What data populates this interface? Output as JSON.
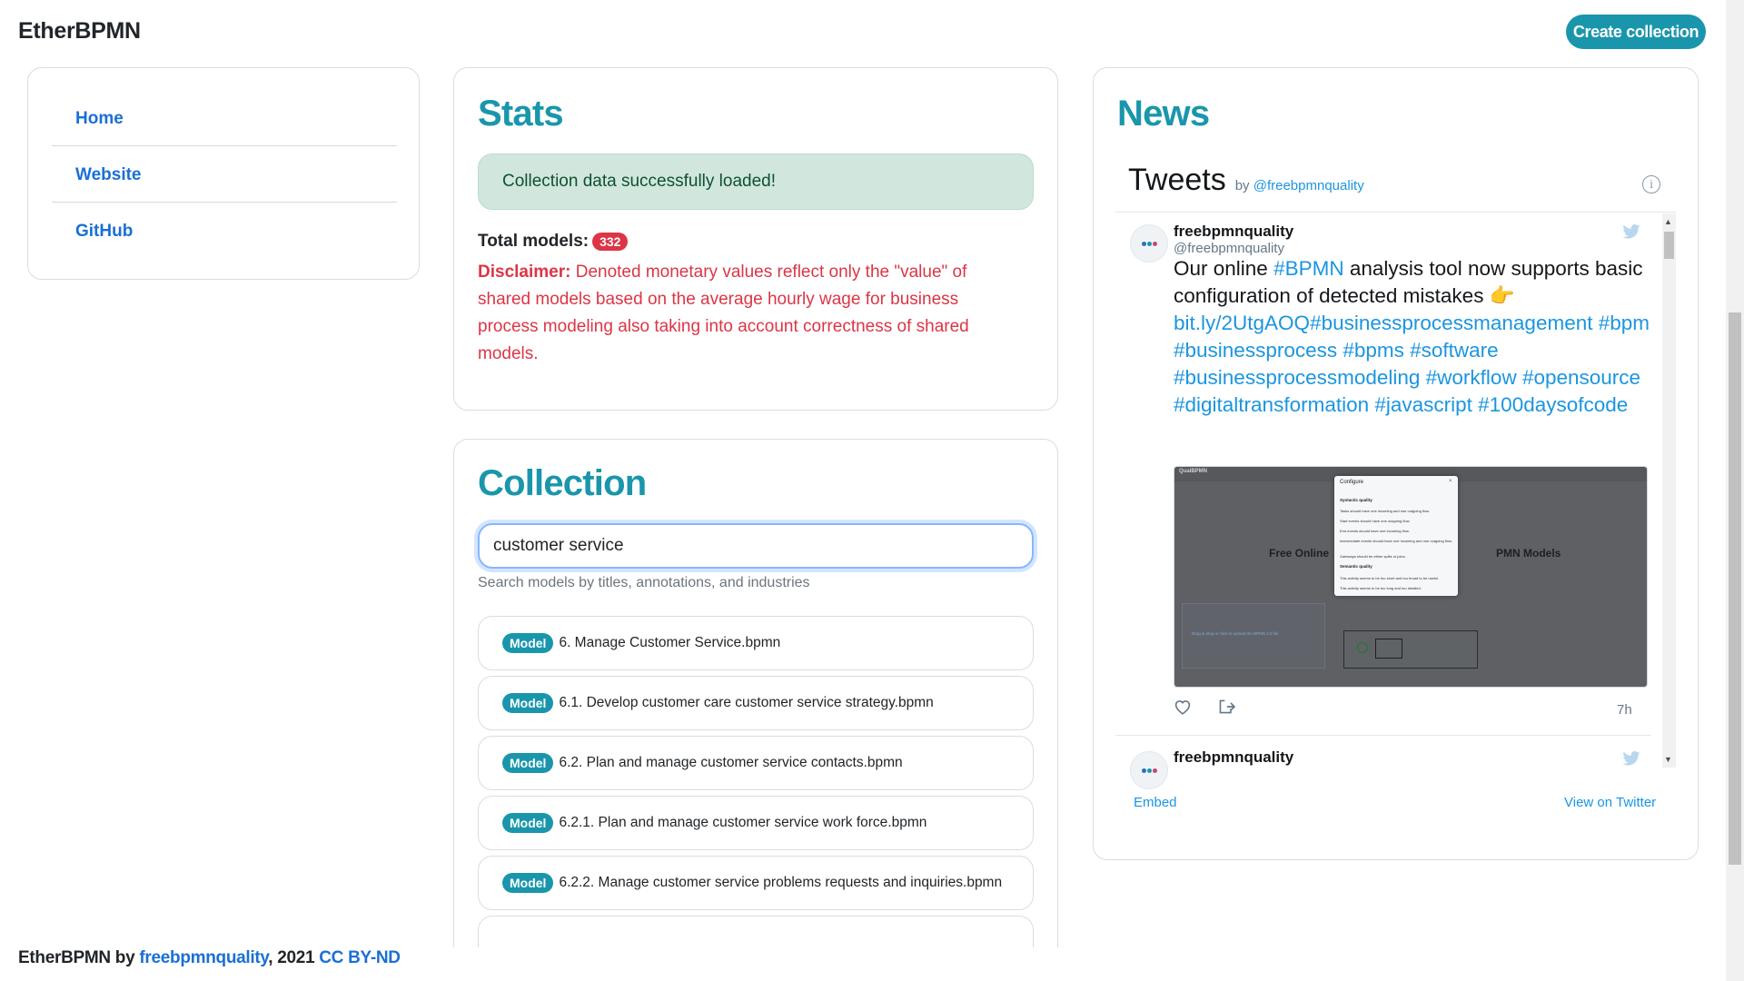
{
  "header": {
    "brand": "EtherBPMN",
    "create_button": "Create collection"
  },
  "nav": {
    "items": [
      {
        "label": "Home"
      },
      {
        "label": "Website"
      },
      {
        "label": "GitHub"
      }
    ]
  },
  "stats": {
    "title": "Stats",
    "alert": "Collection data successfully loaded!",
    "total_label": "Total models:",
    "total_count": "332",
    "disclaimer_label": "Disclaimer:",
    "disclaimer_text": "Denoted monetary values reflect only the \"value\" of shared models based on the average hourly wage for business process modeling also taking into account correctness of shared models."
  },
  "collection": {
    "title": "Collection",
    "search_value": "customer service",
    "search_help": "Search models by titles, annotations, and industries",
    "badge": "Model",
    "models": [
      "6. Manage Customer Service.bpmn",
      "6.1. Develop customer care customer service strategy.bpmn",
      "6.2. Plan and manage customer service contacts.bpmn",
      "6.2.1. Plan and manage customer service work force.bpmn",
      "6.2.2. Manage customer service problems requests and inquiries.bpmn"
    ]
  },
  "news": {
    "title": "News",
    "widget_title": "Tweets",
    "widget_by": "by",
    "widget_handle": "@freebpmnquality",
    "tweet": {
      "name": "freebpmnquality",
      "handle": "@freebpmnquality",
      "text_1": "Our online",
      "tag_bpmn": "#BPMN",
      "text_2": "analysis tool now supports basic configuration of detected mistakes",
      "emoji": "👉",
      "link": "bit.ly/2UtgAOQ#businessprocessmanagement",
      "tags": "#bpm #businessprocess #bpms #software #businessprocessmodeling #workflow #opensource #digitaltransformation #javascript #100daysofcode",
      "time": "7h"
    },
    "next_tweet_name": "freebpmnquality",
    "embed": "Embed",
    "view_on_twitter": "View on Twitter"
  },
  "media": {
    "brand": "QualBPMN",
    "heading_left": "Free Online",
    "heading_right": "PMN Models",
    "dialog_title": "Configure",
    "syntactic": "Syntactic quality",
    "semantic": "Semantic quality",
    "options": [
      "Tasks should have one incoming and one outgoing flow.",
      "Start events should have one outgoing flow.",
      "End events should have one incoming flow.",
      "Intermediate events should have one incoming and one outgoing flow.",
      "Gateways should be either splits or joins.",
      "This activity seems to be too short and too broad to be useful.",
      "This activity seems to be too long and too detailed."
    ],
    "dropzone": "Drag & drop or click to upload the BPMN 2.0 file"
  },
  "footer": {
    "brand": "EtherBPMN",
    "by": "by",
    "author": "freebpmnquality",
    "year": ", 2021",
    "license": "CC BY-ND"
  },
  "colors": {
    "accent": "#1a96ac",
    "link": "#1a6fd6",
    "danger": "#dc3545",
    "success_bg": "#d1e7dd",
    "twitter": "#1b95e0"
  },
  "icons": [
    "info-icon",
    "twitter-bird-icon",
    "heart-icon",
    "share-icon",
    "scroll-up-icon",
    "scroll-down-icon"
  ]
}
